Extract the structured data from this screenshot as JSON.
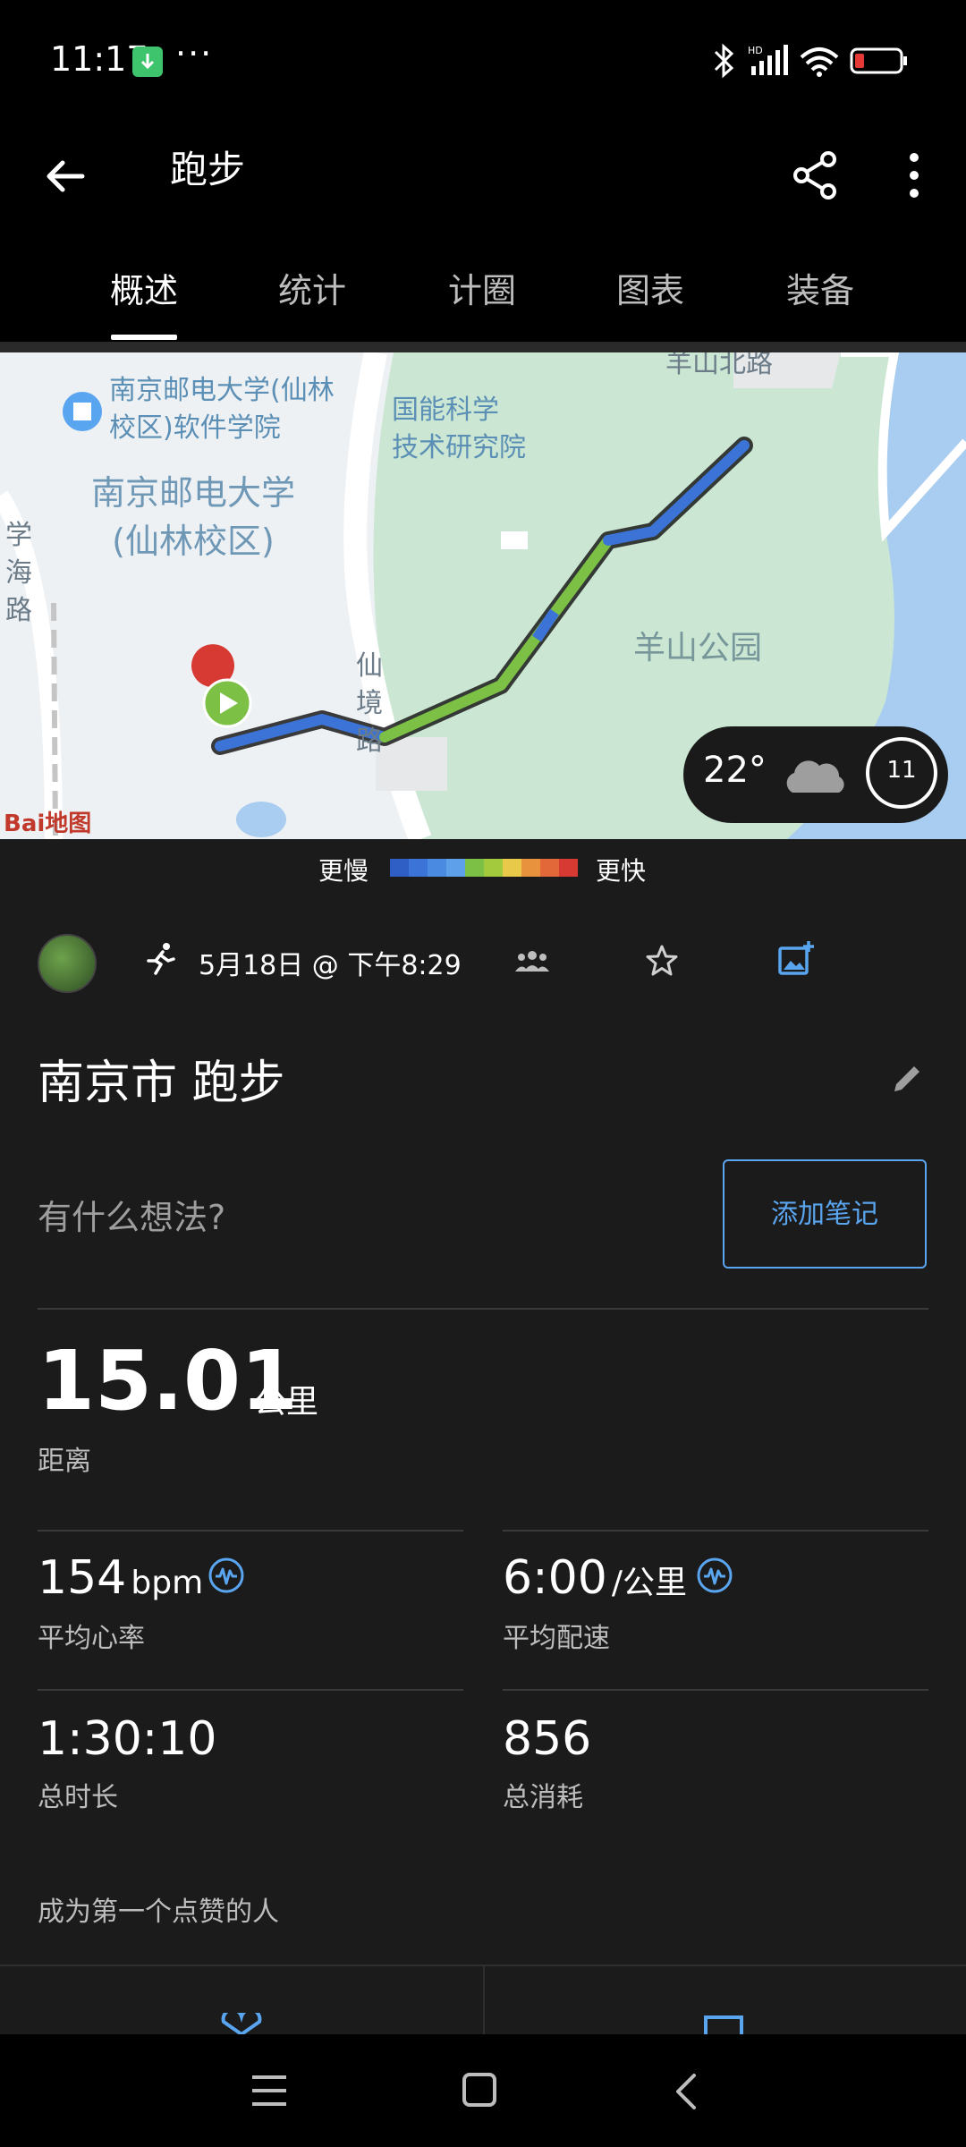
{
  "status_bar": {
    "time": "11:17"
  },
  "app_bar": {
    "title": "跑步"
  },
  "tabs": [
    {
      "label": "概述"
    },
    {
      "label": "统计"
    },
    {
      "label": "计圈"
    },
    {
      "label": "图表"
    },
    {
      "label": "装备"
    }
  ],
  "map": {
    "labels": {
      "school_branch": "南京邮电大学(仙林\n校区)软件学院",
      "institute": "国能科学\n技术研究院",
      "university": "南京邮电大学\n(仙林校区)",
      "road_xuehai": "学\n海\n路",
      "road_xianjing": "仙\n境\n路",
      "park": "羊山公园",
      "road_yangshan": "羊山北路"
    },
    "weather": {
      "temperature": "22°",
      "wind_speed": "11"
    },
    "provider": "Bai地图"
  },
  "pace_legend": {
    "slower": "更慢",
    "faster": "更快",
    "colors": [
      "#2f5fc4",
      "#3b74d6",
      "#4a8ae0",
      "#5fa0ea",
      "#7cc045",
      "#a3c93d",
      "#e8c94a",
      "#e8923d",
      "#e2683a",
      "#d63a32"
    ]
  },
  "activity": {
    "date_time": "5月18日 @ 下午8:29",
    "title": "南京市 跑步",
    "thought_placeholder": "有什么想法?",
    "add_note_label": "添加笔记"
  },
  "distance": {
    "value": "15.01",
    "unit": "公里",
    "label": "距离"
  },
  "stats": {
    "heart_rate": {
      "value": "154",
      "unit": "bpm",
      "label": "平均心率"
    },
    "pace": {
      "value": "6:00",
      "unit": "/公里",
      "label": "平均配速"
    },
    "duration": {
      "value": "1:30:10",
      "label": "总时长"
    },
    "calories": {
      "value": "856",
      "label": "总消耗"
    }
  },
  "social": {
    "first_like": "成为第一个点赞的人"
  },
  "colors": {
    "accent": "#5aa5f0",
    "background": "#1b1b1b",
    "route_fast": "#7cc045",
    "route_slow": "#3b74d6"
  }
}
